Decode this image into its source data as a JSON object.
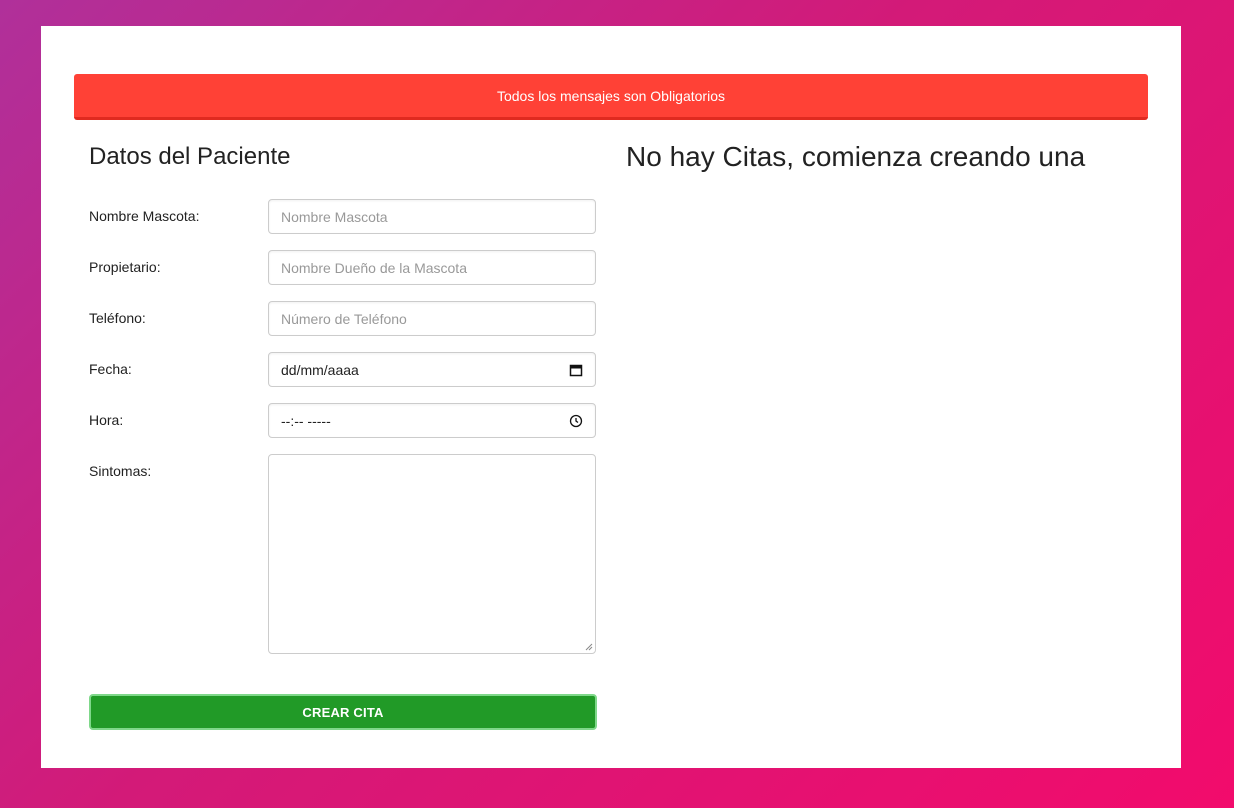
{
  "alert": {
    "message": "Todos los mensajes son Obligatorios",
    "color": "#ff4136"
  },
  "form": {
    "title": "Datos del Paciente",
    "fields": {
      "mascota": {
        "label": "Nombre Mascota:",
        "placeholder": "Nombre Mascota",
        "value": ""
      },
      "propietario": {
        "label": "Propietario:",
        "placeholder": "Nombre Dueño de la Mascota",
        "value": ""
      },
      "telefono": {
        "label": "Teléfono:",
        "placeholder": "Número de Teléfono",
        "value": ""
      },
      "fecha": {
        "label": "Fecha:",
        "display": "dd/mm/aaaa",
        "icon": "calendar-icon"
      },
      "hora": {
        "label": "Hora:",
        "display": "--:-- -----",
        "icon": "clock-icon"
      },
      "sintomas": {
        "label": "Sintomas:",
        "value": ""
      }
    },
    "submit_label": "CREAR CITA",
    "submit_color": "#219a27"
  },
  "appointments": {
    "empty_message": "No hay Citas, comienza creando una"
  }
}
